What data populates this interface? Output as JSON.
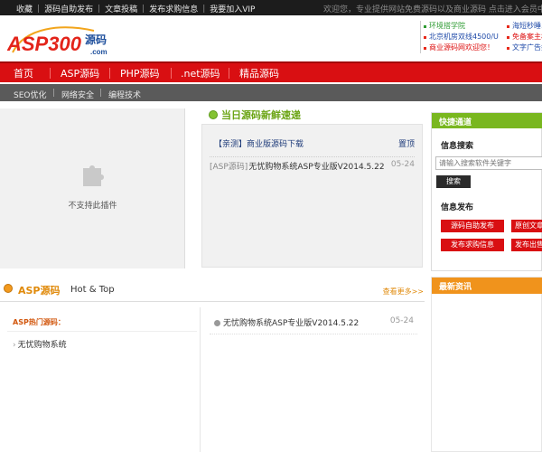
{
  "topbar": {
    "links": [
      "收藏",
      "源码自助发布",
      "文章投稿",
      "发布求购信息",
      "我要加入VIP"
    ],
    "notice": "欢迎您，专业提供网站免费源码以及商业源码  点击进入会员中心"
  },
  "header": {
    "logo_text": "ASP300",
    "logo_cn": "源码",
    "logo_domain": ".com",
    "promo_left": [
      {
        "text": "环境搭学院",
        "color": "green"
      },
      {
        "text": "北京机房双线4500/U",
        "color": "blue"
      },
      {
        "text": "商业源码网欢迎您！",
        "color": "red"
      }
    ],
    "promo_right": [
      {
        "text": "海短秒睡...",
        "color": "blue"
      },
      {
        "text": "免备案主机...",
        "color": "red"
      },
      {
        "text": "文字广告招...",
        "color": "blue"
      }
    ]
  },
  "nav": {
    "items": [
      "首页",
      "ASP源码",
      "PHP源码",
      ".net源码",
      "精品源码"
    ]
  },
  "subnav": {
    "items": [
      "SEO优化",
      "网络安全",
      "编程技术"
    ]
  },
  "plugin": {
    "text": "不支持此插件",
    "icon": "puzzle-icon"
  },
  "news": {
    "title": "当日源码新鲜速递",
    "row1": {
      "text": "【亲测】商业版源码下载",
      "tag": "置顶"
    },
    "row2": {
      "source": "[ASP源码]",
      "text": "无忧购物系统ASP专业版V2014.5.22",
      "date": "05-24"
    }
  },
  "quick": {
    "title": "快捷通道",
    "search_label": "信息搜索",
    "search_placeholder": "请输入搜索软件关键字",
    "search_button": "搜索",
    "publish_label": "信息发布",
    "buttons": [
      "源码自助发布",
      "原创文章",
      "发布求购信息",
      "发布出售"
    ]
  },
  "latest": {
    "title": "最新资讯"
  },
  "asp": {
    "title": "ASP源码",
    "subtitle": "Hot & Top",
    "more": "查看更多>>",
    "hot_title": "ASP热门源码：",
    "hot_items": [
      "无忧购物系统"
    ],
    "list": [
      {
        "text": "无忧购物系统ASP专业版V2014.5.22",
        "date": "05-24"
      }
    ]
  },
  "colors": {
    "nav_red": "#d90f12",
    "green_accent": "#79b71f",
    "orange_accent": "#f0931c"
  }
}
